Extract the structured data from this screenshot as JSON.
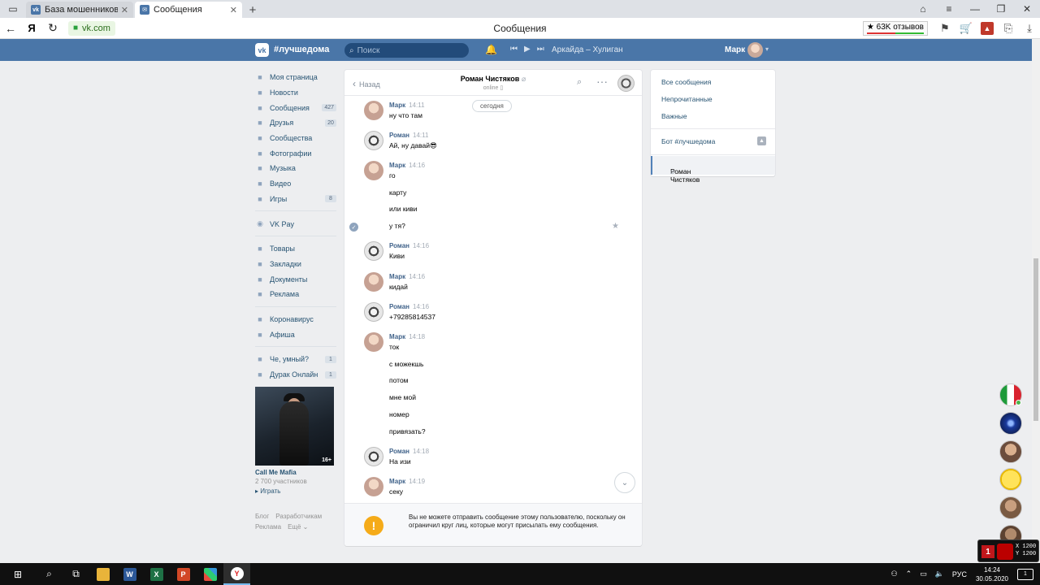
{
  "browser": {
    "tabs": [
      {
        "label": "База мошенников ВКонта",
        "active": false
      },
      {
        "label": "Сообщения",
        "active": true
      }
    ],
    "url": "vk.com",
    "page_title": "Сообщения",
    "yandex_logo": "Я",
    "reviews_label": "★ 63K отзывов"
  },
  "vk_header": {
    "logo": "vk",
    "brand": "#лучшедома",
    "search_placeholder": "Поиск",
    "track": "Аркайда – Хулиган",
    "user_name": "Марк"
  },
  "left_nav": {
    "items": [
      {
        "label": "Моя страница",
        "icon": "home-icon",
        "badge": ""
      },
      {
        "label": "Новости",
        "icon": "news-icon",
        "badge": ""
      },
      {
        "label": "Сообщения",
        "icon": "message-icon",
        "badge": "427"
      },
      {
        "label": "Друзья",
        "icon": "friends-icon",
        "badge": "20"
      },
      {
        "label": "Сообщества",
        "icon": "groups-icon",
        "badge": ""
      },
      {
        "label": "Фотографии",
        "icon": "camera-icon",
        "badge": ""
      },
      {
        "label": "Музыка",
        "icon": "music-icon",
        "badge": ""
      },
      {
        "label": "Видео",
        "icon": "video-icon",
        "badge": ""
      },
      {
        "label": "Игры",
        "icon": "games-icon",
        "badge": "8"
      }
    ],
    "pay": "VK Pay",
    "items2": [
      {
        "label": "Товары",
        "icon": "bag-icon"
      },
      {
        "label": "Закладки",
        "icon": "star-icon"
      },
      {
        "label": "Документы",
        "icon": "document-icon"
      },
      {
        "label": "Реклама",
        "icon": "megaphone-icon"
      }
    ],
    "items3": [
      {
        "label": "Коронавирус",
        "icon": "virus-icon"
      },
      {
        "label": "Афиша",
        "icon": "play-icon"
      }
    ],
    "items4": [
      {
        "label": "Че, умный?",
        "icon": "flask-icon",
        "badge": "1"
      },
      {
        "label": "Дурак Онлайн",
        "icon": "cards-icon",
        "badge": "1"
      }
    ],
    "promo": {
      "age": "16+",
      "title": "Call Me Mafia",
      "subtitle": "2 700 участников",
      "play": "▸ Играть"
    },
    "footer": {
      "blog": "Блог",
      "dev": "Разработчикам",
      "ads": "Реклама",
      "more": "Ещё ⌄"
    }
  },
  "chat": {
    "back_label": "Назад",
    "peer_name": "Роман Чистяков",
    "peer_status": "online",
    "date_label": "сегодня",
    "messages": [
      {
        "author": "Марк",
        "time": "14:11",
        "lines": [
          "ну что там"
        ]
      },
      {
        "author": "Роман",
        "time": "14:11",
        "lines": [
          "Ай, ну давай😎"
        ]
      },
      {
        "author": "Марк",
        "time": "14:16",
        "lines": [
          "го",
          "карту",
          "или киви",
          "у тя?"
        ]
      },
      {
        "author": "Роман",
        "time": "14:16",
        "lines": [
          "Киви"
        ]
      },
      {
        "author": "Марк",
        "time": "14:16",
        "lines": [
          "кидай"
        ]
      },
      {
        "author": "Роман",
        "time": "14:16",
        "lines": [
          "+79285814537"
        ]
      },
      {
        "author": "Марк",
        "time": "14:18",
        "lines": [
          "ток",
          "с можекшь",
          "потом",
          "мне мой",
          "номер",
          "привязать?"
        ]
      },
      {
        "author": "Роман",
        "time": "14:18",
        "lines": [
          "На изи"
        ]
      },
      {
        "author": "Марк",
        "time": "14:19",
        "lines": [
          "секу"
        ]
      }
    ],
    "warning": "Вы не можете отправить сообщение этому пользователю, поскольку он ограничил круг лиц, которые могут присылать ему сообщения."
  },
  "right_panel": {
    "filters": [
      "Все сообщения",
      "Непрочитанные",
      "Важные"
    ],
    "bot": "Бот #лучшедома",
    "selected": "Роман Чистяков"
  },
  "overlay": {
    "badge": "1",
    "x": "X 1200",
    "y": "Y 1200"
  },
  "taskbar": {
    "lang": "РУС",
    "time": "14:24",
    "date": "30.05.2020",
    "notifications": "1"
  }
}
